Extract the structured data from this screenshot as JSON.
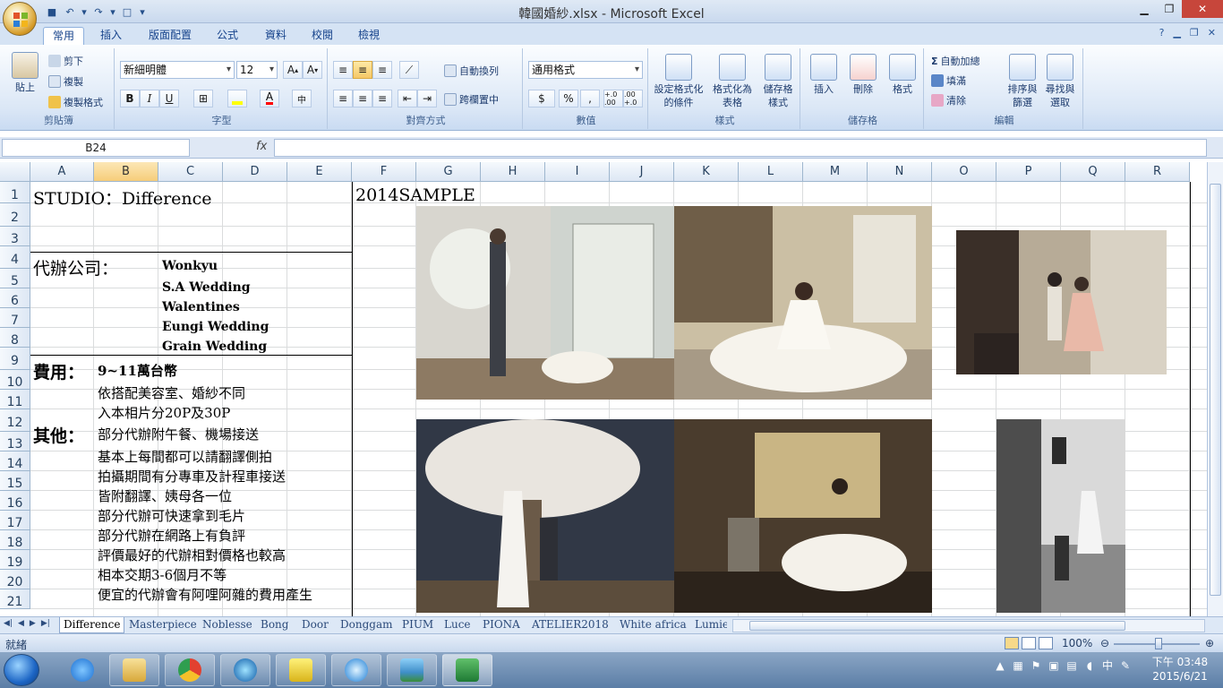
{
  "window": {
    "title": "韓國婚紗.xlsx - Microsoft Excel",
    "minimize": "▁",
    "restore": "❐",
    "close": "✕"
  },
  "ribbon": {
    "tabs": [
      "常用",
      "插入",
      "版面配置",
      "公式",
      "資料",
      "校閱",
      "檢視"
    ],
    "clipboard": {
      "label": "剪貼簿",
      "paste": "貼上",
      "cut": "剪下",
      "copy": "複製",
      "format_painter": "複製格式"
    },
    "font": {
      "label": "字型",
      "name": "新細明體",
      "size": "12"
    },
    "alignment": {
      "label": "對齊方式",
      "wrap": "自動換列",
      "merge": "跨欄置中"
    },
    "number": {
      "label": "數值",
      "format": "通用格式",
      "currency": "$",
      "percent": "%",
      "comma": ",",
      "inc_decimal": "+.0 .00",
      "dec_decimal": ".00 +.0"
    },
    "styles": {
      "label": "樣式",
      "conditional": [
        "設定格式化",
        "的條件"
      ],
      "table": [
        "格式化為",
        "表格"
      ],
      "cell": [
        "儲存格",
        "樣式"
      ]
    },
    "cells": {
      "label": "儲存格",
      "insert": "插入",
      "delete": "刪除",
      "format": "格式"
    },
    "editing": {
      "label": "編輯",
      "autosum": "自動加總",
      "fill": "填滿",
      "clear": "清除",
      "sort": [
        "排序與",
        "篩選"
      ],
      "find": [
        "尋找與",
        "選取"
      ]
    }
  },
  "formula_bar": {
    "name_box": "B24",
    "fx": "fx",
    "value": ""
  },
  "columns": [
    "A",
    "B",
    "C",
    "D",
    "E",
    "F",
    "G",
    "H",
    "I",
    "J",
    "K",
    "L",
    "M",
    "N",
    "O",
    "P",
    "Q",
    "R"
  ],
  "rows": [
    "1",
    "2",
    "3",
    "4",
    "5",
    "6",
    "7",
    "8",
    "9",
    "10",
    "11",
    "12",
    "13",
    "14",
    "15",
    "16",
    "17",
    "18",
    "19",
    "20",
    "21"
  ],
  "cells": {
    "a1": "STUDIO：Difference",
    "f1": "2014SAMPLE",
    "a4": "代辦公司：",
    "c4": "Wonkyu",
    "c5": "S.A Wedding",
    "c6": "Walentines",
    "c7": "Eungi Wedding",
    "c8": "Grain Wedding",
    "a9": "費用：",
    "b9": "9~11萬台幣",
    "b10": "依搭配美容室、婚紗不同",
    "b11": "入本相片分20P及30P",
    "a12": "其他：",
    "b12": "部分代辦附午餐、機場接送",
    "b13": "基本上每間都可以請翻譯側拍",
    "b14": "拍攝期間有分專車及計程車接送",
    "b15": "皆附翻譯、姨母各一位",
    "b16": "部分代辦可快速拿到毛片",
    "b17": "部分代辦在網路上有負評",
    "b18": "評價最好的代辦相對價格也較高",
    "b19": "相本交期3-6個月不等",
    "b20": "便宜的代辦會有阿哩阿雜的費用產生"
  },
  "sheet_tabs": [
    "Difference",
    "Masterpiece",
    "Noblesse",
    "Bong",
    "Door",
    "Donggam",
    "PIUM",
    "Luce",
    "PIONA",
    "ATELIER2018",
    "White africa",
    "Lumie"
  ],
  "status": {
    "ready": "就緒",
    "zoom": "100%"
  },
  "taskbar": {
    "apps": [
      "internet-explorer",
      "file-explorer",
      "chrome",
      "media-player",
      "pin-app",
      "itunes",
      "photo-viewer",
      "excel"
    ],
    "tray_lang": "中",
    "time": "下午 03:48",
    "date": "2015/6/21"
  }
}
